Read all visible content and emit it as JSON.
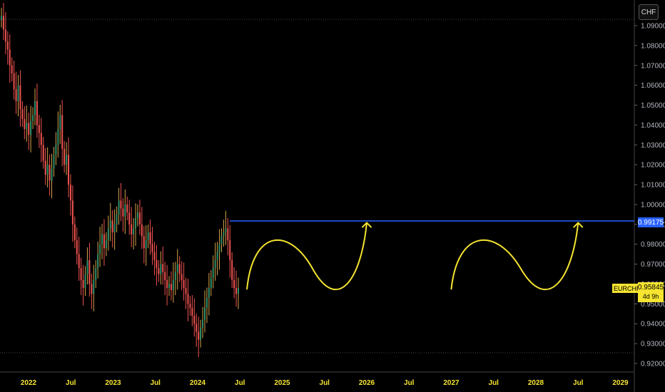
{
  "header": {
    "currency_label": "CHF"
  },
  "chart_data": {
    "type": "candlestick",
    "symbol": "EURCHF",
    "y_axis_ticks": [
      "1.09000",
      "1.08000",
      "1.07000",
      "1.06000",
      "1.05000",
      "1.04000",
      "1.03000",
      "1.02000",
      "1.01000",
      "1.00000",
      "0.99000",
      "0.98000",
      "0.97000",
      "0.96000",
      "0.95000",
      "0.94000",
      "0.93000",
      "0.92000"
    ],
    "x_axis_ticks": [
      "2022",
      "Jul",
      "2023",
      "Jul",
      "2024",
      "Jul",
      "2025",
      "Jul",
      "2026",
      "Jul",
      "2027",
      "Jul",
      "2028",
      "Jul",
      "2029"
    ],
    "ylim": [
      0.9175,
      1.0985
    ],
    "horizontal_line": {
      "value": 0.99175,
      "label": "0.99175",
      "color": "#2962ff"
    },
    "last_price": {
      "symbol_label": "EURCHF",
      "value_label": "0.95845",
      "countdown": "4d 9h",
      "color": "#f5e430"
    },
    "price_series_weekly_close": [
      1.095,
      1.088,
      1.082,
      1.078,
      1.07,
      1.066,
      1.058,
      1.052,
      1.06,
      1.048,
      1.043,
      1.038,
      1.041,
      1.035,
      1.042,
      1.045,
      1.052,
      1.04,
      1.036,
      1.03,
      1.022,
      1.015,
      1.02,
      1.012,
      1.018,
      1.025,
      1.03,
      1.038,
      1.045,
      1.028,
      1.02,
      1.025,
      1.01,
      1.002,
      0.99,
      0.982,
      0.975,
      0.968,
      0.962,
      0.958,
      0.965,
      0.972,
      0.96,
      0.955,
      0.962,
      0.968,
      0.975,
      0.98,
      0.985,
      0.978,
      0.982,
      0.988,
      0.992,
      0.986,
      0.99,
      0.995,
      1.002,
      0.998,
      0.994,
      1.0,
      0.996,
      0.99,
      0.985,
      0.988,
      0.993,
      0.996,
      0.99,
      0.984,
      0.978,
      0.982,
      0.986,
      0.98,
      0.976,
      0.972,
      0.968,
      0.965,
      0.97,
      0.966,
      0.962,
      0.958,
      0.96,
      0.957,
      0.962,
      0.966,
      0.97,
      0.965,
      0.962,
      0.958,
      0.955,
      0.95,
      0.948,
      0.944,
      0.94,
      0.936,
      0.932,
      0.938,
      0.942,
      0.948,
      0.953,
      0.958,
      0.963,
      0.968,
      0.972,
      0.976,
      0.98,
      0.984,
      0.986,
      0.988,
      0.982,
      0.972,
      0.962,
      0.958,
      0.955,
      0.958
    ],
    "annotations": [
      {
        "type": "curved-arrow",
        "color": "#f5e430",
        "from_date": "2024-08",
        "to_date": "2026-01",
        "from_value": 0.9575,
        "to_value": 0.9908
      },
      {
        "type": "curved-arrow",
        "color": "#f5e430",
        "from_date": "2027-01",
        "to_date": "2028-07",
        "from_value": 0.9575,
        "to_value": 0.9908
      }
    ],
    "colors": {
      "up": "#26a69a",
      "down": "#ef5350",
      "mixed_up": "#d6a24a",
      "axis_text": "#b2b5be",
      "x_axis_text": "#f5e430"
    }
  }
}
